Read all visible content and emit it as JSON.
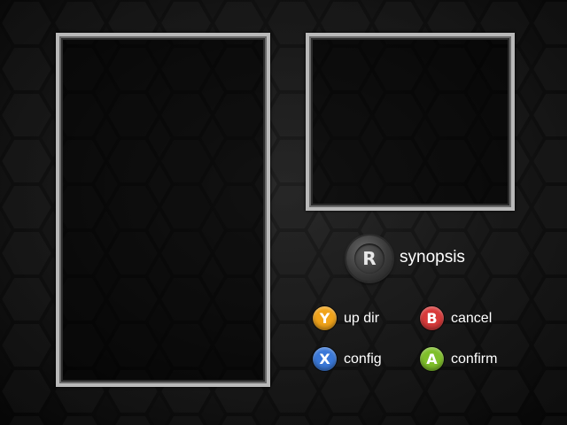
{
  "colors": {
    "y_button": "#f0a31a",
    "b_button": "#d83a3a",
    "x_button": "#3a78d8",
    "a_button": "#7fbf2a"
  },
  "synopsis": {
    "button_glyph": "R",
    "label": "synopsis"
  },
  "hints": {
    "y": {
      "glyph": "Y",
      "label": "up dir"
    },
    "b": {
      "glyph": "B",
      "label": "cancel"
    },
    "x": {
      "glyph": "X",
      "label": "config"
    },
    "a": {
      "glyph": "A",
      "label": "confirm"
    }
  }
}
